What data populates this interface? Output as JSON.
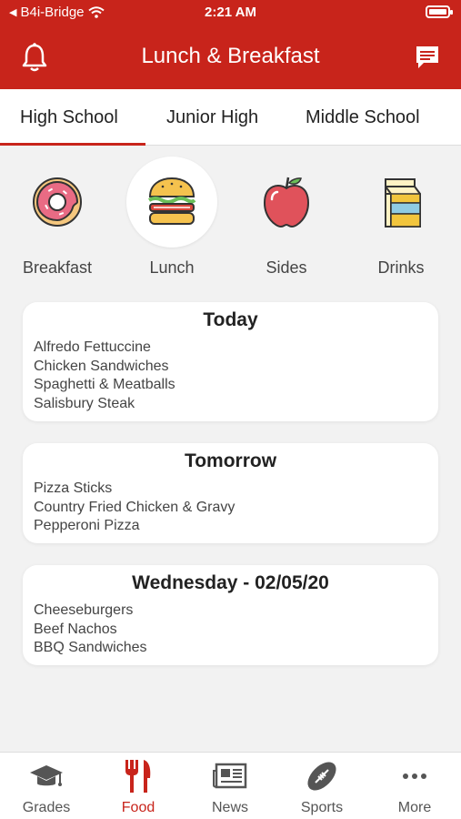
{
  "status": {
    "carrier": "B4i-Bridge",
    "time": "2:21 AM"
  },
  "header": {
    "title": "Lunch & Breakfast"
  },
  "tabs": [
    {
      "label": "High School"
    },
    {
      "label": "Junior High"
    },
    {
      "label": "Middle School"
    }
  ],
  "categories": [
    {
      "label": "Breakfast",
      "icon": "donut-icon"
    },
    {
      "label": "Lunch",
      "icon": "burger-icon"
    },
    {
      "label": "Sides",
      "icon": "apple-icon"
    },
    {
      "label": "Drinks",
      "icon": "milk-carton-icon"
    }
  ],
  "menus": [
    {
      "title": "Today",
      "items": [
        "Alfredo Fettuccine",
        "Chicken Sandwiches",
        "Spaghetti & Meatballs",
        "Salisbury Steak"
      ]
    },
    {
      "title": "Tomorrow",
      "items": [
        "Pizza Sticks",
        "Country Fried Chicken & Gravy",
        "Pepperoni Pizza"
      ]
    },
    {
      "title": "Wednesday - 02/05/20",
      "items": [
        "Cheeseburgers",
        "Beef Nachos",
        "BBQ Sandwiches"
      ]
    }
  ],
  "bottom_nav": [
    {
      "label": "Grades",
      "icon": "graduation-cap-icon"
    },
    {
      "label": "Food",
      "icon": "fork-knife-icon"
    },
    {
      "label": "News",
      "icon": "newspaper-icon"
    },
    {
      "label": "Sports",
      "icon": "football-icon"
    },
    {
      "label": "More",
      "icon": "more-dots-icon"
    }
  ],
  "colors": {
    "accent": "#c8241b",
    "background": "#f2f2f2",
    "card": "#ffffff"
  }
}
